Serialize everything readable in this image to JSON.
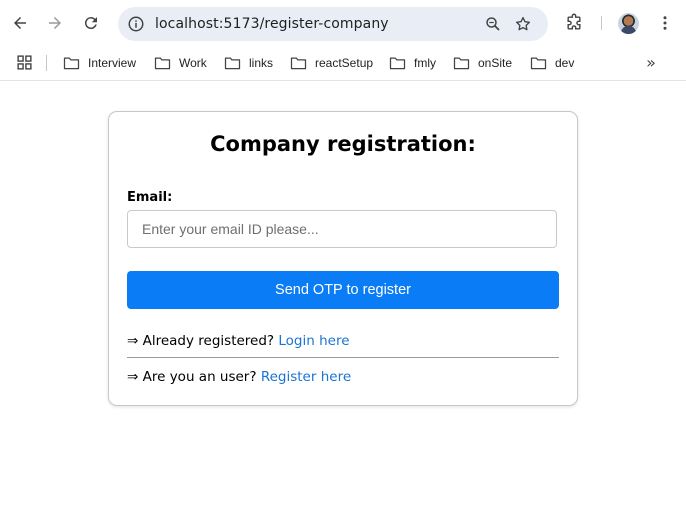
{
  "browser": {
    "url": "localhost:5173/register-company",
    "bookmarks": [
      "Interview",
      "Work",
      "links",
      "reactSetup",
      "fmly",
      "onSite",
      "dev"
    ],
    "more_bookmarks": "»"
  },
  "form": {
    "title": "Company registration:",
    "email_label": "Email:",
    "email_placeholder": "Enter your email ID please...",
    "email_value": "",
    "submit_label": "Send OTP to register",
    "arrow": "⇒",
    "already_text": "Already registered?",
    "login_link": "Login here",
    "user_text": "Are you an user?",
    "register_link": "Register here"
  },
  "colors": {
    "primary_button": "#0a7cf6",
    "link": "#1a73d6",
    "omnibox_bg": "#e9eef6"
  }
}
